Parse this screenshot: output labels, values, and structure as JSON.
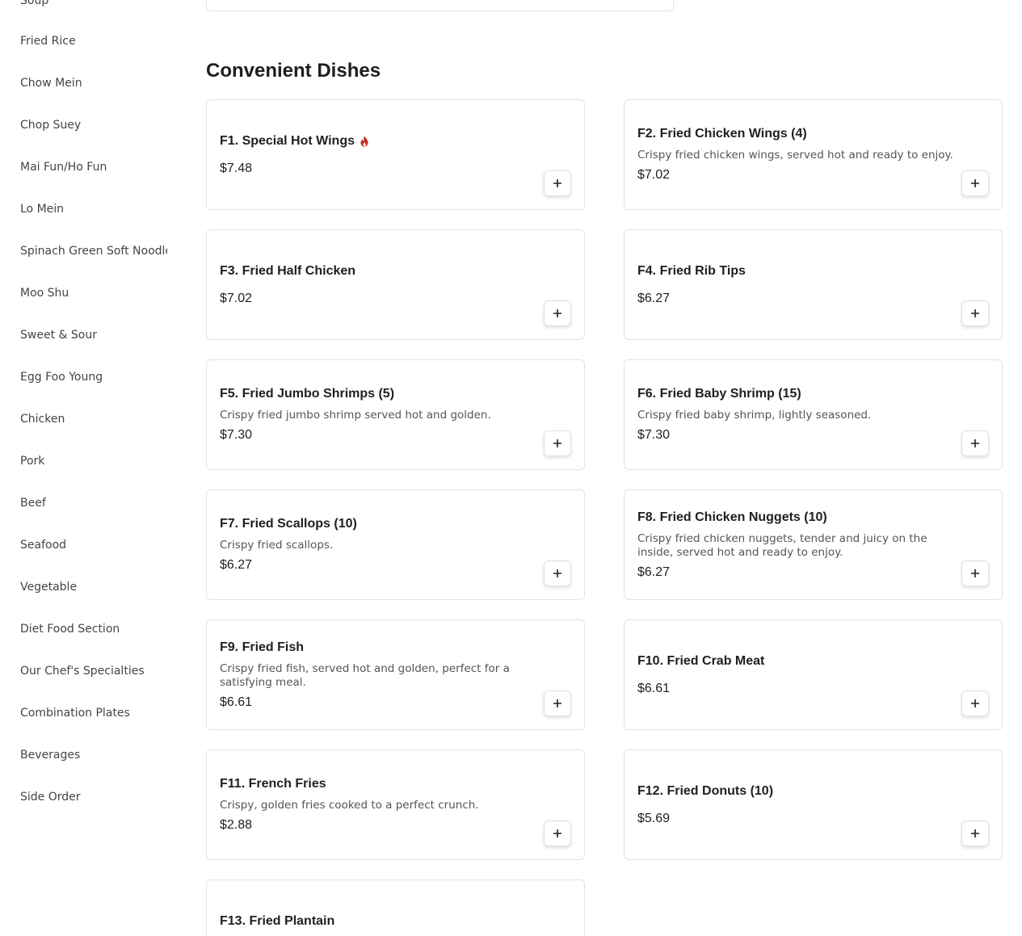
{
  "sidebar": {
    "items": [
      {
        "label": "Soup"
      },
      {
        "label": "Fried Rice"
      },
      {
        "label": "Chow Mein"
      },
      {
        "label": "Chop Suey"
      },
      {
        "label": "Mai Fun/Ho Fun"
      },
      {
        "label": "Lo Mein"
      },
      {
        "label": "Spinach Green Soft Noodle"
      },
      {
        "label": "Moo Shu"
      },
      {
        "label": "Sweet & Sour"
      },
      {
        "label": "Egg Foo Young"
      },
      {
        "label": "Chicken"
      },
      {
        "label": "Pork"
      },
      {
        "label": "Beef"
      },
      {
        "label": "Seafood"
      },
      {
        "label": "Vegetable"
      },
      {
        "label": "Diet Food Section"
      },
      {
        "label": "Our Chef's Specialties"
      },
      {
        "label": "Combination Plates"
      },
      {
        "label": "Beverages"
      },
      {
        "label": "Side Order"
      }
    ]
  },
  "section": {
    "title": "Convenient Dishes",
    "items": [
      {
        "name": "F1. Special Hot Wings",
        "desc": "",
        "price": "$7.48",
        "spicy": true,
        "icon": "flame-icon"
      },
      {
        "name": "F2. Fried Chicken Wings (4)",
        "desc": "Crispy fried chicken wings, served hot and ready to enjoy.",
        "price": "$7.02"
      },
      {
        "name": "F3. Fried Half Chicken",
        "desc": "",
        "price": "$7.02"
      },
      {
        "name": "F4. Fried Rib Tips",
        "desc": "",
        "price": "$6.27"
      },
      {
        "name": "F5. Fried Jumbo Shrimps (5)",
        "desc": "Crispy fried jumbo shrimp served hot and golden.",
        "price": "$7.30"
      },
      {
        "name": "F6. Fried Baby Shrimp (15)",
        "desc": "Crispy fried baby shrimp, lightly seasoned.",
        "price": "$7.30"
      },
      {
        "name": "F7. Fried Scallops (10)",
        "desc": "Crispy fried scallops.",
        "price": "$6.27"
      },
      {
        "name": "F8. Fried Chicken Nuggets (10)",
        "desc": "Crispy fried chicken nuggets, tender and juicy on the inside, served hot and ready to enjoy.",
        "price": "$6.27"
      },
      {
        "name": "F9. Fried Fish",
        "desc": "Crispy fried fish, served hot and golden, perfect for a satisfying meal.",
        "price": "$6.61"
      },
      {
        "name": "F10. Fried Crab Meat",
        "desc": "",
        "price": "$6.61"
      },
      {
        "name": "F11. French Fries",
        "desc": "Crispy, golden fries cooked to a perfect crunch.",
        "price": "$2.88"
      },
      {
        "name": "F12. Fried Donuts (10)",
        "desc": "",
        "price": "$5.69"
      },
      {
        "name": "F13. Fried Plantain",
        "desc": "",
        "price": ""
      }
    ]
  },
  "colors": {
    "spicy": "#c62828",
    "border": "#e3e3e3"
  }
}
